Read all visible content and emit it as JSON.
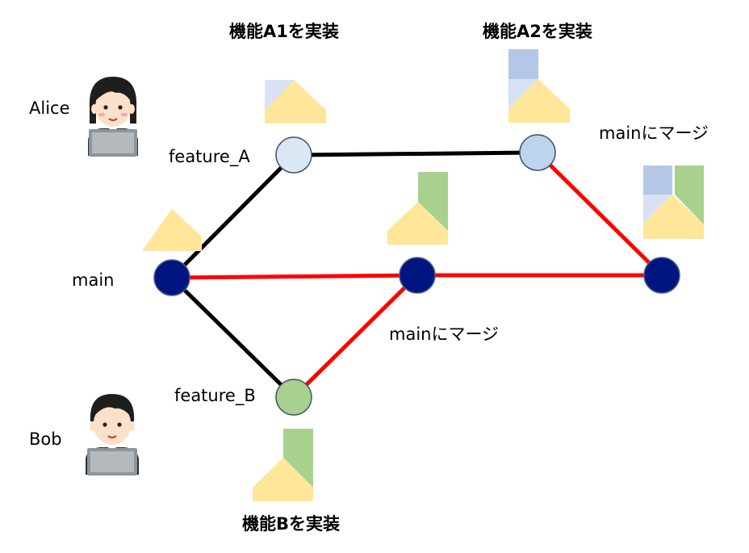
{
  "people": {
    "alice": "Alice",
    "bob": "Bob"
  },
  "branches": {
    "feature_a": "feature_A",
    "main": "main",
    "feature_b": "feature_B"
  },
  "captions": {
    "feature_a1": "機能A1を実装",
    "feature_a2": "機能A2を実装",
    "feature_b": "機能Bを実装",
    "merge_a": "mainにマージ",
    "merge_b": "mainにマージ"
  },
  "colors": {
    "main_node": "#001580",
    "feature_a_node": "#dce7f4",
    "feature_a2_node": "#bcd5ec",
    "feature_b_node": "#a9d18e",
    "branch_line": "#000000",
    "merge_line": "#ff0000",
    "piece_base": "#ffe699",
    "piece_a1": "#d9e2f3",
    "piece_a2": "#b4c7e7",
    "piece_b": "#a9d18e"
  },
  "icons": {
    "alice": "person-with-laptop-icon",
    "bob": "person-with-laptop-icon"
  }
}
